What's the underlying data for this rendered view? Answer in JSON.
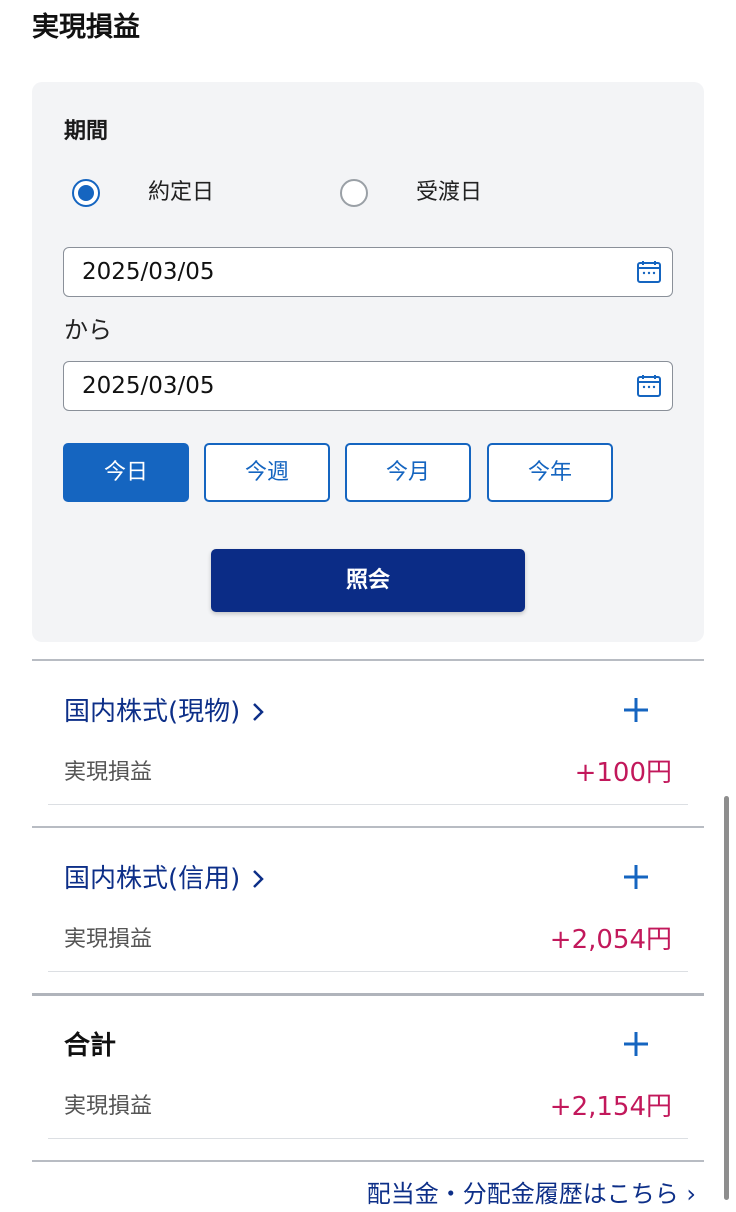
{
  "page": {
    "title": "実現損益"
  },
  "filter": {
    "period_label": "期間",
    "radio_contract": "約定日",
    "radio_delivery": "受渡日",
    "radio_selected": "約定日",
    "date_from": "2025/03/05",
    "date_separator": "から",
    "date_to": "2025/03/05",
    "quick_buttons": [
      "今日",
      "今週",
      "今月",
      "今年"
    ],
    "active_quick_button": "今日",
    "query_button": "照会"
  },
  "sections": [
    {
      "title": "国内株式(現物)",
      "label": "実現損益",
      "value": "+100円"
    },
    {
      "title": "国内株式(信用)",
      "label": "実現損益",
      "value": "+2,054円"
    }
  ],
  "total": {
    "title": "合計",
    "label": "実現損益",
    "value": "+2,154円"
  },
  "footer": {
    "link_text": "配当金・分配金履歴はこちら"
  },
  "icons": {
    "calendar": "calendar-icon",
    "plus": "plus-icon",
    "chevron": "chevron-right-icon"
  },
  "colors": {
    "primary": "#1565c0",
    "navy": "#0b2c86",
    "link": "#0d2f88",
    "profit": "#c2185b",
    "panel_bg": "#f3f4f6"
  }
}
